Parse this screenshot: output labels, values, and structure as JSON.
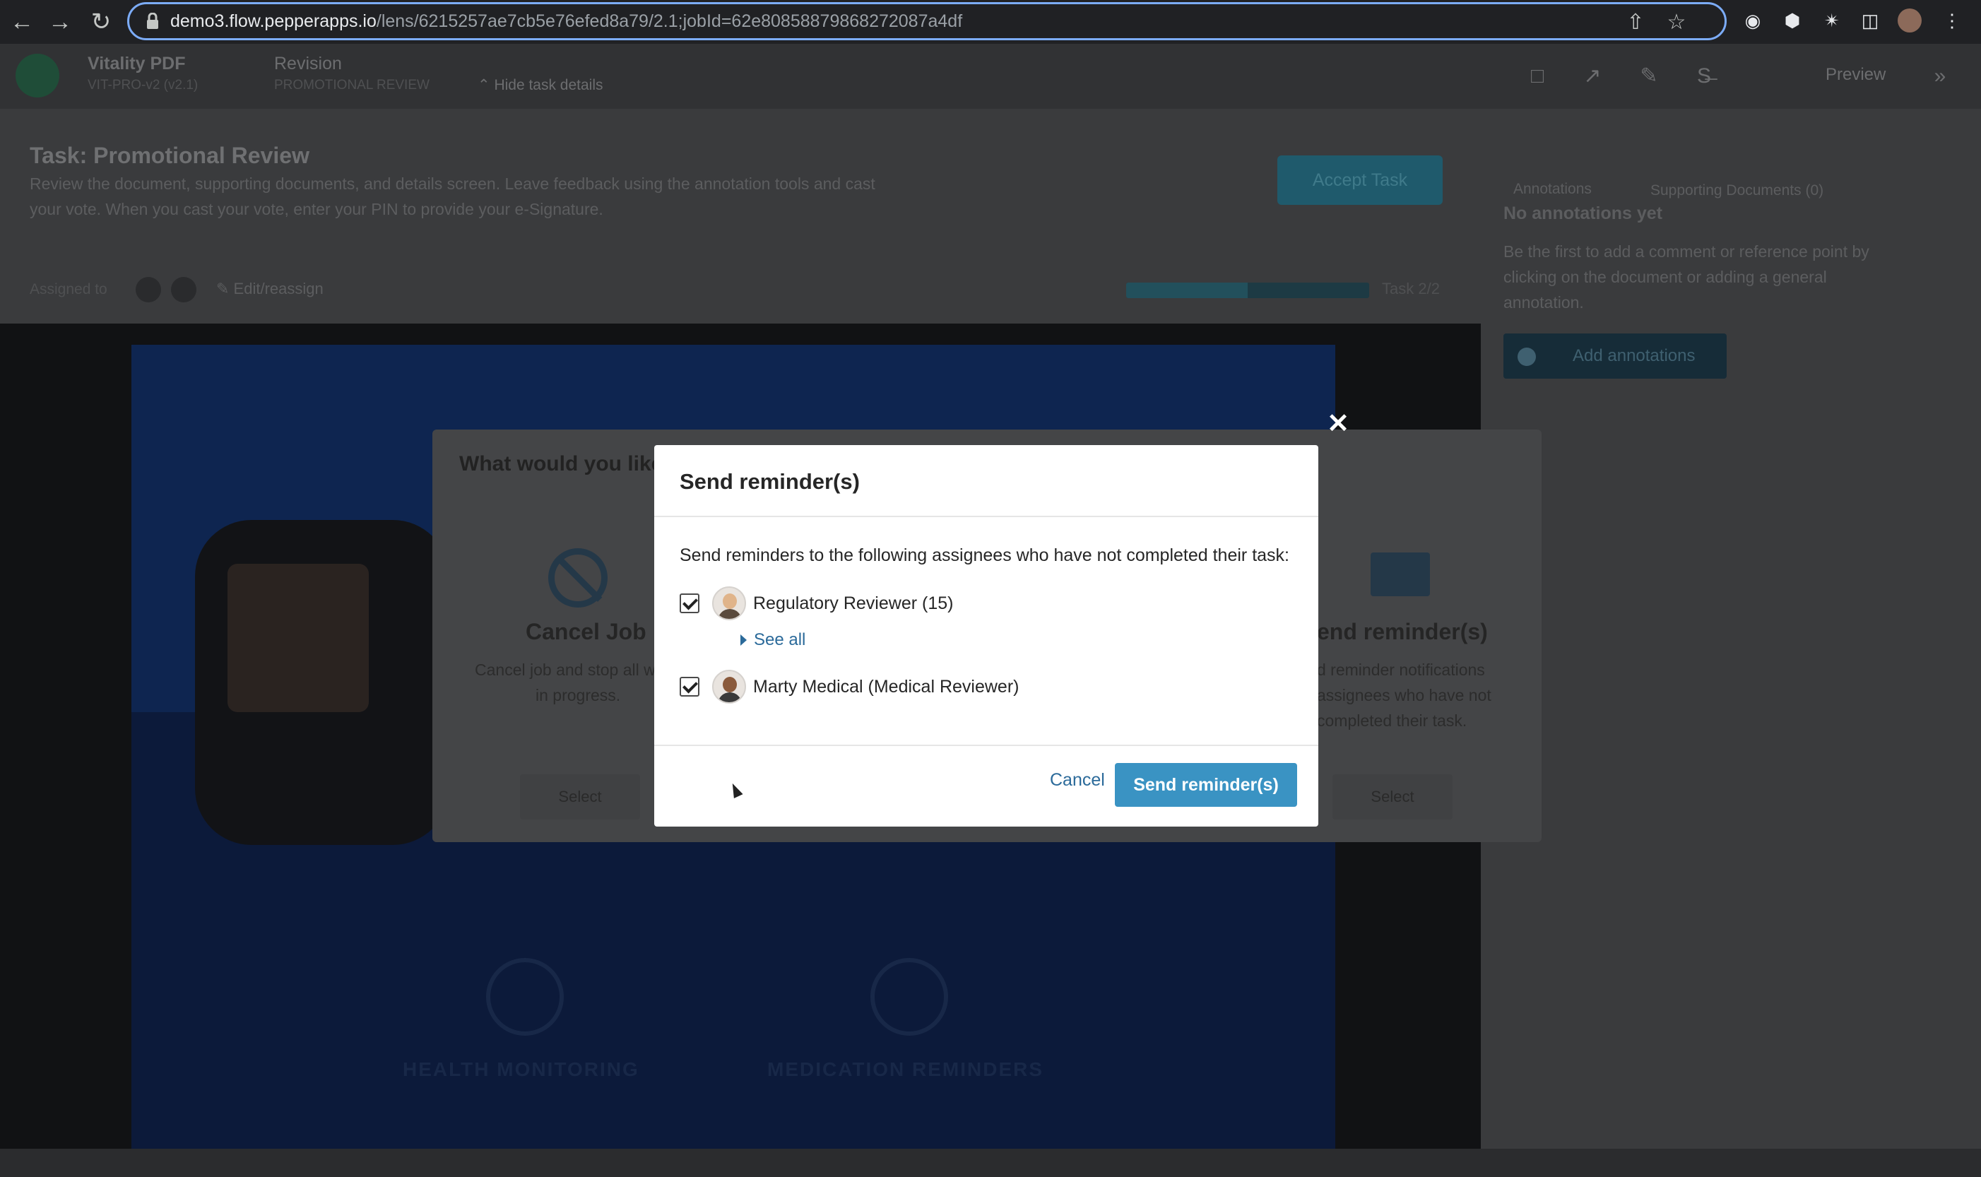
{
  "browser": {
    "url_host": "demo3.flow.pepperapps.io",
    "url_path": "/lens/6215257ae7cb5e76efed8a79/2.1;jobId=62e808588798682720​87a4df"
  },
  "app": {
    "doc_name": "Vitality PDF",
    "doc_sub": "VIT-PRO-v2 (v2.1)",
    "revision_label": "Revision",
    "revision_sub": "PROMOTIONAL REVIEW",
    "hide_details": "Hide task details",
    "preview": "Preview"
  },
  "task": {
    "title": "Task: Promotional Review",
    "description": "Review the document, supporting documents, and details screen. Leave feedback using the annotation tools and cast your vote. When you cast your vote, enter your PIN to provide your e-Signature.",
    "accept_label": "Accept Task",
    "assigned_to": "Assigned to",
    "edit_reassign": "Edit/reassign",
    "progress": 0.5,
    "task_count": "Task 2/2"
  },
  "right_panel": {
    "tabs": [
      "Annotations",
      "Supporting Documents (0)"
    ],
    "title": "No annotations yet",
    "text": "Be the first to add a comment or reference point by clicking on the document or adding a general annotation.",
    "add_button": "Add annotations"
  },
  "document": {
    "features": [
      "HEALTH MONITORING",
      "MEDICATION REMINDERS"
    ]
  },
  "background_dialog": {
    "title": "What would you like",
    "options": [
      {
        "title": "Cancel Job",
        "text": "Cancel job and stop all w",
        "text2": "in progress.",
        "select": "Select"
      },
      {
        "title": "end reminder(s)",
        "text": "d reminder notifications",
        "text2": "assignees who have not",
        "text3": "completed their task.",
        "select": "Select"
      }
    ]
  },
  "modal": {
    "title": "Send reminder(s)",
    "description": "Send reminders to the following assignees who have not completed their task:",
    "assignees": [
      {
        "label": "Regulatory Reviewer (15)",
        "checked": true
      },
      {
        "label": "Marty Medical (Medical Reviewer)",
        "checked": true
      }
    ],
    "see_all": "See all",
    "cancel_label": "Cancel",
    "send_label": "Send reminder(s)"
  },
  "colors": {
    "primary": "#3a93c3",
    "link": "#2b6a9a"
  }
}
